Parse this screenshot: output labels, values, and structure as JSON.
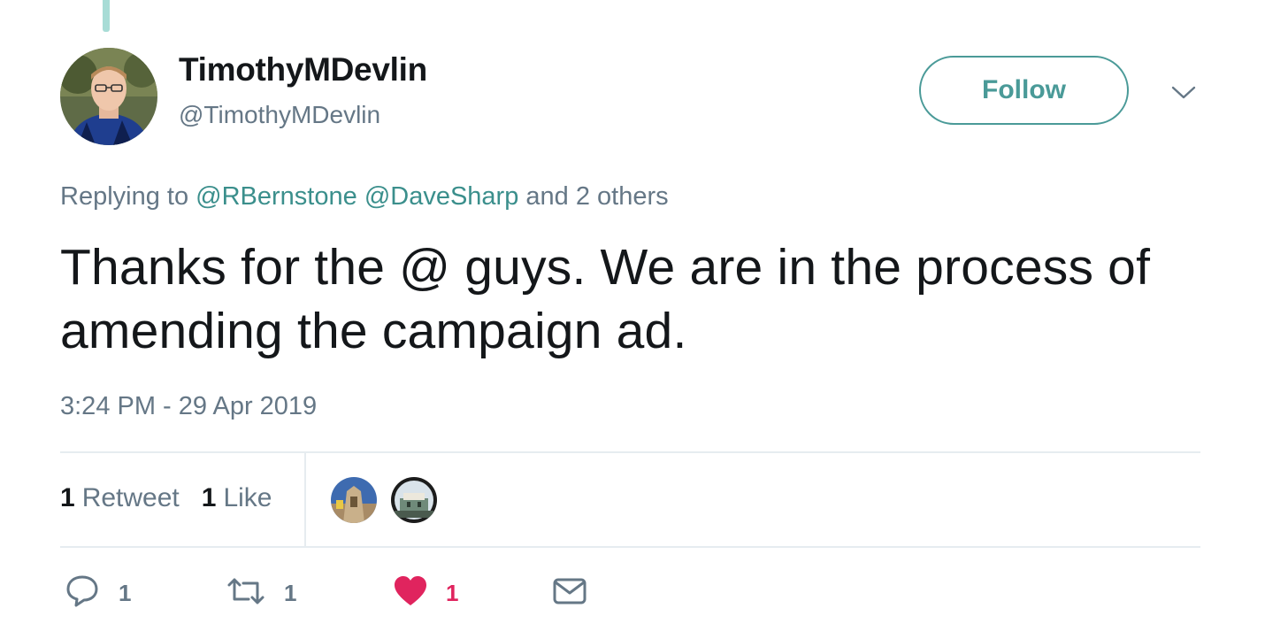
{
  "author": {
    "display_name": "TimothyMDevlin",
    "handle": "@TimothyMDevlin"
  },
  "follow_button": {
    "label": "Follow"
  },
  "reply_context": {
    "prefix": "Replying to",
    "mentions": [
      "@RBernstone",
      "@DaveSharp"
    ],
    "suffix": "and 2 others"
  },
  "tweet": {
    "text": "Thanks for the @ guys. We are in the process of amending the campaign ad.",
    "timestamp": "3:24 PM - 29 Apr 2019"
  },
  "stats": {
    "retweets_count": "1",
    "retweets_label": "Retweet",
    "likes_count": "1",
    "likes_label": "Like"
  },
  "actions": {
    "reply_count": "1",
    "retweet_count": "1",
    "like_count": "1"
  },
  "icons": {
    "reply": "reply-icon",
    "retweet": "retweet-icon",
    "like": "heart-icon",
    "dm": "mail-icon",
    "caret": "chevron-down-icon"
  },
  "colors": {
    "accent": "#4a9a98",
    "mention": "#3b8f8c",
    "like": "#e0245e",
    "muted": "#657786",
    "text": "#14171a"
  }
}
